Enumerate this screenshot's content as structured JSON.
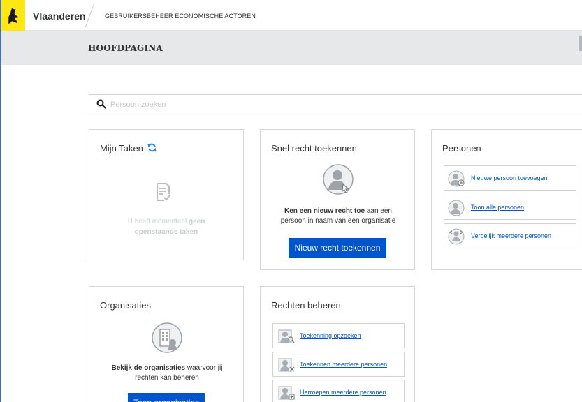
{
  "header": {
    "brand": "Vlaanderen",
    "app_title": "GEBRUIKERSBEHEER ECONOMISCHE ACTOREN"
  },
  "page": {
    "title": "HOOFDPAGINA"
  },
  "search": {
    "placeholder": "Persoon zoeken",
    "value": ""
  },
  "cards": {
    "taken": {
      "title": "Mijn Taken",
      "empty_pre": "U heeft momenteel",
      "empty_bold1": "geen",
      "empty_bold2": "openstaande taken"
    },
    "snel": {
      "title": "Snel recht toekennen",
      "desc_bold": "Ken een nieuw recht toe",
      "desc_rest1": " aan een",
      "desc_rest2": "persoon in naam van een organisatie",
      "button": "Nieuw recht toekennen"
    },
    "personen": {
      "title": "Personen",
      "links": [
        {
          "label": "Nieuwe persoon toevoegen"
        },
        {
          "label": "Toon alle personen"
        },
        {
          "label": "Vergelijk meerdere personen"
        }
      ]
    },
    "organisaties": {
      "title": "Organisaties",
      "desc_bold": "Bekijk de organisaties",
      "desc_rest1": " waarvoor jij",
      "desc_rest2": "rechten kan beheren",
      "button": "Toon organisaties"
    },
    "rechten": {
      "title": "Rechten beheren",
      "links": [
        {
          "label": "Toekenning opzoeken"
        },
        {
          "label": "Toekennen meerdere personen"
        },
        {
          "label": "Herroepen meerdere personen"
        }
      ]
    }
  },
  "colors": {
    "accent": "#0055cc",
    "brand_yellow": "#ffe615",
    "band_gray": "#e6e8ea",
    "refresh_blue": "#1f87e0"
  },
  "icons": {
    "logo": "flemish-lion-icon",
    "search": "search-icon",
    "refresh": "refresh-icon",
    "tasks": "checklist-icon",
    "user": "user-icon",
    "building": "building-icon"
  }
}
